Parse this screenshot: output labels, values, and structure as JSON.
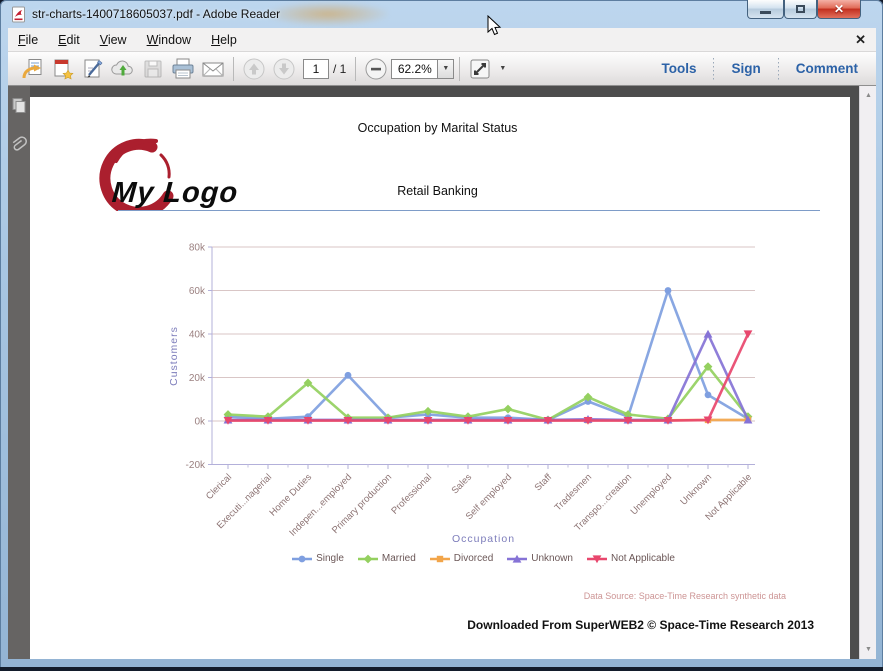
{
  "window": {
    "title": "str-charts-1400718605037.pdf - Adobe Reader"
  },
  "menu": {
    "items": [
      "File",
      "Edit",
      "View",
      "Window",
      "Help"
    ],
    "close_glyph": "✕"
  },
  "toolbar": {
    "page_current": "1",
    "page_total": "/ 1",
    "zoom_value": "62.2%",
    "tools": "Tools",
    "sign": "Sign",
    "comment": "Comment"
  },
  "icons": {
    "scroll_up": "▲",
    "scroll_down": "▼",
    "zoom_out": "−",
    "dropdown": "▼",
    "caret": "▼",
    "fit_page": "⤢",
    "close": "✕"
  },
  "document": {
    "title": "Occupation by Marital Status",
    "subtitle": "Retail Banking",
    "logo_text": "My Logo",
    "data_source": "Data Source: Space-Time Research synthetic data",
    "footer": "Downloaded From SuperWEB2 © Space-Time Research 2013"
  },
  "chart_data": {
    "type": "line",
    "title": "",
    "xlabel": "Occupation",
    "ylabel": "Customers",
    "ylim": [
      -20000,
      80000
    ],
    "grid": true,
    "legend_position": "bottom",
    "yticks": [
      {
        "value": 80000,
        "label": "80k"
      },
      {
        "value": 60000,
        "label": "60k"
      },
      {
        "value": 40000,
        "label": "40k"
      },
      {
        "value": 20000,
        "label": "20k"
      },
      {
        "value": 0,
        "label": "0k"
      },
      {
        "value": -20000,
        "label": "-20k"
      }
    ],
    "categories": [
      "Clerical",
      "Executi...nagerial",
      "Home Duties",
      "Indepen...employed",
      "Primary production",
      "Professional",
      "Sales",
      "Self employed",
      "Staff",
      "Tradesmen",
      "Transpo...creation",
      "Unemployed",
      "Unknown",
      "Not Applicable"
    ],
    "series": [
      {
        "name": "Single",
        "color": "#7f9fe0",
        "marker": "circle",
        "values": [
          2000,
          1000,
          2000,
          21000,
          1500,
          3000,
          1500,
          1500,
          500,
          9000,
          2000,
          60000,
          12000,
          1000
        ]
      },
      {
        "name": "Married",
        "color": "#94d05f",
        "marker": "diamond",
        "values": [
          3000,
          2000,
          17500,
          1500,
          1500,
          4500,
          2000,
          5500,
          500,
          11000,
          3000,
          1000,
          25000,
          2000
        ]
      },
      {
        "name": "Divorced",
        "color": "#f2a54a",
        "marker": "square",
        "values": [
          300,
          300,
          300,
          300,
          300,
          300,
          300,
          300,
          300,
          400,
          300,
          300,
          500,
          500
        ]
      },
      {
        "name": "Unknown",
        "color": "#8673d6",
        "marker": "triangle",
        "values": [
          500,
          500,
          500,
          500,
          500,
          500,
          500,
          500,
          500,
          800,
          500,
          500,
          40000,
          500
        ]
      },
      {
        "name": "Not Applicable",
        "color": "#e8476d",
        "marker": "triangle-down",
        "values": [
          200,
          200,
          200,
          200,
          200,
          200,
          200,
          200,
          200,
          200,
          200,
          200,
          400,
          40000
        ]
      }
    ]
  }
}
